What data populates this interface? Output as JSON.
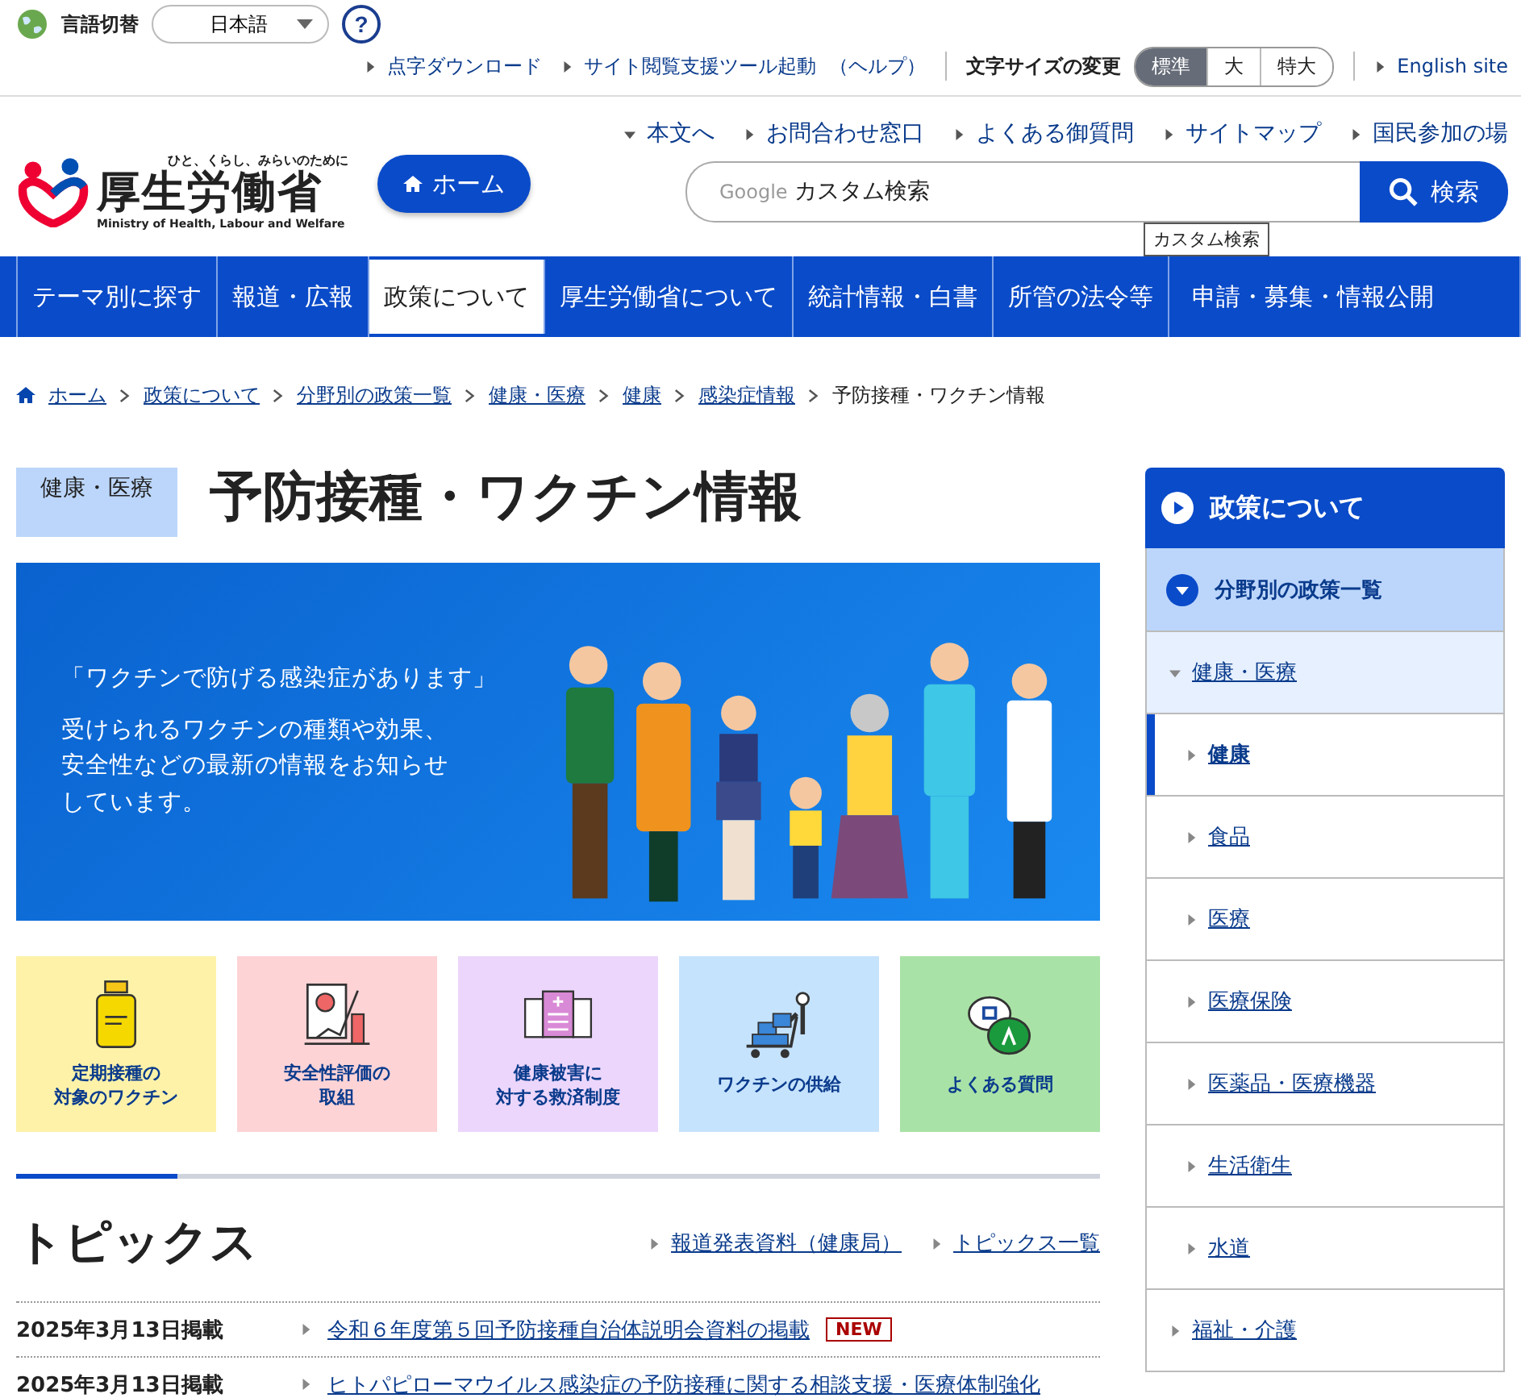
{
  "utility": {
    "language_label": "言語切替",
    "language_value": "日本語",
    "help_icon": "?",
    "links": [
      {
        "label": "点字ダウンロード"
      },
      {
        "label": "サイト閲覧支援ツール起動"
      }
    ],
    "help_link": "（ヘルプ）",
    "font_size_label": "文字サイズの変更",
    "font_sizes": [
      {
        "label": "標準",
        "selected": true
      },
      {
        "label": "大",
        "selected": false
      },
      {
        "label": "特大",
        "selected": false
      }
    ],
    "english_link": "English site"
  },
  "header": {
    "logo_tagline": "ひと、くらし、みらいのために",
    "logo_name": "厚生労働省",
    "logo_english": "Ministry of Health, Labour and Welfare",
    "home_button": "ホーム",
    "links": [
      {
        "label": "本文へ",
        "kind": "down"
      },
      {
        "label": "お問合わせ窓口",
        "kind": "right"
      },
      {
        "label": "よくある御質問",
        "kind": "right"
      },
      {
        "label": "サイトマップ",
        "kind": "right"
      },
      {
        "label": "国民参加の場",
        "kind": "right"
      }
    ],
    "search_brand": "Google",
    "search_placeholder": "カスタム検索",
    "search_button": "検索",
    "search_tooltip": "カスタム検索"
  },
  "nav": [
    {
      "label": "テーマ別に探す",
      "selected": false
    },
    {
      "label": "報道・広報",
      "selected": false
    },
    {
      "label": "政策について",
      "selected": true
    },
    {
      "label": "厚生労働省について",
      "selected": false
    },
    {
      "label": "統計情報・白書",
      "selected": false
    },
    {
      "label": "所管の法令等",
      "selected": false
    },
    {
      "label": "申請・募集・情報公開",
      "selected": false
    }
  ],
  "breadcrumb": [
    "ホーム",
    "政策について",
    "分野別の政策一覧",
    "健康・医療",
    "健康",
    "感染症情報",
    "予防接種・ワクチン情報"
  ],
  "category_tag": "健康・医療",
  "page_title": "予防接種・ワクチン情報",
  "banner": {
    "headline": "「ワクチンで防げる感染症があります」",
    "lines": [
      "受けられるワクチンの種類や効果、",
      "安全性などの最新の情報をお知らせ",
      "しています。"
    ]
  },
  "tiles": [
    {
      "lines": [
        "定期接種の",
        "対象のワクチン"
      ],
      "kind": "vial",
      "color": "#fdf2a8"
    },
    {
      "lines": [
        "安全性評価の",
        "取組"
      ],
      "kind": "report",
      "color": "#fdd3d6"
    },
    {
      "lines": [
        "健康被害に",
        "対する救済制度"
      ],
      "kind": "building",
      "color": "#ecd6fb"
    },
    {
      "lines": [
        "ワクチンの供給"
      ],
      "kind": "cart",
      "color": "#c6e3fd"
    },
    {
      "lines": [
        "よくある質問"
      ],
      "kind": "qa",
      "color": "#a9e2a6"
    }
  ],
  "topics": {
    "title": "トピックス",
    "links": [
      "報道発表資料（健康局）",
      "トピックス一覧"
    ],
    "items": [
      {
        "date": "2025年3月13日掲載",
        "title": "令和６年度第５回予防接種自治体説明会資料の掲載",
        "new_badge": "NEW"
      },
      {
        "date": "2025年3月13日掲載",
        "title": "ヒトパピローマウイルス感染症の予防接種に関する相談支援・医療体制強化"
      }
    ]
  },
  "sidebar": {
    "title": "政策について",
    "section": {
      "label": "分野別の政策一覧",
      "expanded": true,
      "items": [
        {
          "label": "健康・医療",
          "expanded": true,
          "selected": false,
          "children": [
            {
              "label": "健康",
              "selected": true
            },
            {
              "label": "食品",
              "selected": false
            },
            {
              "label": "医療",
              "selected": false
            },
            {
              "label": "医療保険",
              "selected": false
            },
            {
              "label": "医薬品・医療機器",
              "selected": false
            },
            {
              "label": "生活衛生",
              "selected": false
            },
            {
              "label": "水道",
              "selected": false
            }
          ]
        },
        {
          "label": "福祉・介護",
          "expanded": false,
          "selected": false
        }
      ]
    }
  }
}
